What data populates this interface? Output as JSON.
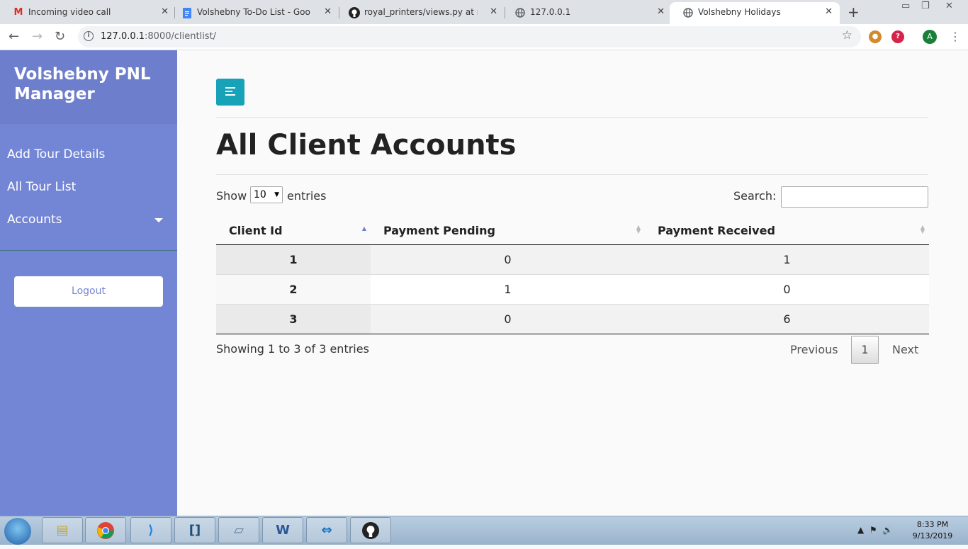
{
  "browser": {
    "tabs": [
      {
        "title": "Incoming video call",
        "icon": "gmail-icon",
        "active": false
      },
      {
        "title": "Volshebny To-Do List - Google D",
        "icon": "google-docs-icon",
        "active": false
      },
      {
        "title": "royal_printers/views.py at maste",
        "icon": "github-icon",
        "active": false
      },
      {
        "title": "127.0.0.1",
        "icon": "globe-icon",
        "active": false
      },
      {
        "title": "Volshebny Holidays",
        "icon": "globe-icon",
        "active": true
      }
    ],
    "url_host": "127.0.0.1",
    "url_path": ":8000/clientlist/",
    "profile_initial": "A"
  },
  "sidebar": {
    "title": "Volshebny PNL Manager",
    "items": [
      {
        "label": "Add Tour Details"
      },
      {
        "label": "All Tour List"
      },
      {
        "label": "Accounts",
        "has_dropdown": true
      }
    ],
    "logout_label": "Logout"
  },
  "main": {
    "heading": "All Client Accounts",
    "length": {
      "show_label": "Show",
      "value": "10",
      "entries_label": "entries"
    },
    "search_label": "Search:",
    "search_value": "",
    "columns": [
      "Client Id",
      "Payment Pending",
      "Payment Received"
    ],
    "sorted_column": "Client Id",
    "sort_direction": "ascending",
    "rows": [
      {
        "client_id": "1",
        "payment_pending": "0",
        "payment_received": "1"
      },
      {
        "client_id": "2",
        "payment_pending": "1",
        "payment_received": "0"
      },
      {
        "client_id": "3",
        "payment_pending": "0",
        "payment_received": "6"
      }
    ],
    "info": "Showing 1 to 3 of 3 entries",
    "pagination": {
      "previous": "Previous",
      "current": "1",
      "next": "Next"
    }
  },
  "taskbar": {
    "time": "8:33 PM",
    "date": "9/13/2019"
  },
  "colors": {
    "sidebar": "#7386d5",
    "sidebar_header": "#6d7fcc",
    "toggle_button": "#17a2b8"
  }
}
